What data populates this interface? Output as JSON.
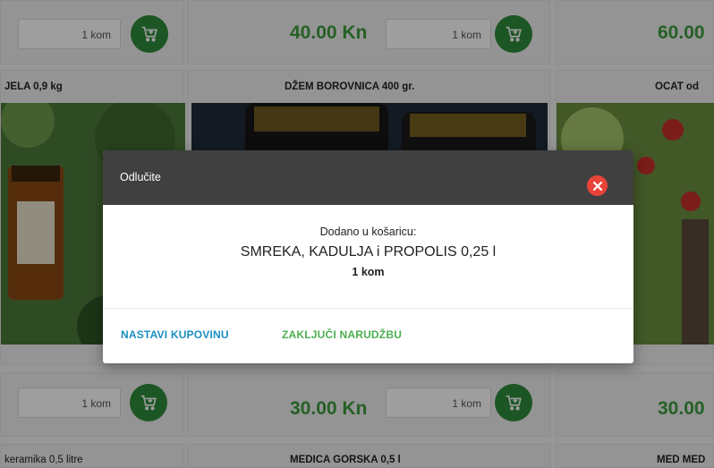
{
  "products_top": [
    {
      "price": "",
      "qty": "1 kom"
    },
    {
      "price": "40.00 Kn",
      "qty": "1 kom"
    },
    {
      "price": "60.00",
      "qty": ""
    }
  ],
  "product_titles_mid": [
    "JELA 0,9 kg",
    "DŽEM BOROVNICA 400 gr.",
    "OCAT od"
  ],
  "products_bottom": [
    {
      "price": "",
      "qty": "1 kom"
    },
    {
      "price": "30.00 Kn",
      "qty": "1 kom"
    },
    {
      "price": "30.00",
      "qty": ""
    }
  ],
  "product_titles_bottom": [
    "keramika 0,5 litre",
    "MEDICA GORSKA 0,5 l",
    "MED MED"
  ],
  "dialog": {
    "title": "Odlučite",
    "added_label": "Dodano u košaricu:",
    "product_name": "SMREKA, KADULJA i PROPOLIS 0,25 l",
    "quantity": "1 kom",
    "continue_label": "NASTAVI KUPOVINU",
    "checkout_label": "ZAKLJUČI NARUDŽBU"
  },
  "colors": {
    "price_green": "#3d9b3d",
    "cart_button": "#2e8b3a",
    "dialog_header": "#404040",
    "close_red": "#e9443a",
    "continue_blue": "#1a8fc0",
    "checkout_green": "#4caf50"
  },
  "icons": [
    "add-to-cart-icon",
    "close-icon"
  ]
}
